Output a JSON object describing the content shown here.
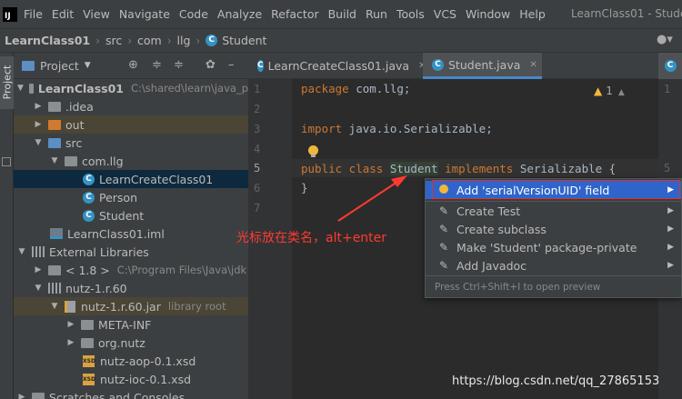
{
  "menubar": {
    "logo": "IJ",
    "items": [
      "File",
      "Edit",
      "View",
      "Navigate",
      "Code",
      "Analyze",
      "Refactor",
      "Build",
      "Run",
      "Tools",
      "VCS",
      "Window",
      "Help"
    ],
    "window_title": "LearnClass01 - Stude"
  },
  "breadcrumb": {
    "items": [
      "LearnClass01",
      "src",
      "com",
      "llg",
      "Student"
    ]
  },
  "left_tool": {
    "label": "Project"
  },
  "project_panel": {
    "title": "Project",
    "tree": [
      {
        "label": "LearnClass01",
        "extra": "C:\\shared\\learn\\java_p",
        "bold": true
      },
      {
        "label": ".idea"
      },
      {
        "label": "out"
      },
      {
        "label": "src"
      },
      {
        "label": "com.llg"
      },
      {
        "label": "LearnCreateClass01"
      },
      {
        "label": "Person"
      },
      {
        "label": "Student"
      },
      {
        "label": "LearnClass01.iml"
      },
      {
        "label": "External Libraries"
      },
      {
        "label": "< 1.8 >",
        "extra": "C:\\Program Files\\Java\\jdk"
      },
      {
        "label": "nutz-1.r.60"
      },
      {
        "label": "nutz-1.r.60.jar",
        "extra": "library root"
      },
      {
        "label": "META-INF"
      },
      {
        "label": "org.nutz"
      },
      {
        "label": "nutz-aop-0.1.xsd"
      },
      {
        "label": "nutz-ioc-0.1.xsd"
      },
      {
        "label": "Scratches and Consoles"
      }
    ],
    "class_icon_letter": "C",
    "xsd_icon_text": "XSD"
  },
  "tabs": [
    {
      "label": "LearnCreateClass01.java",
      "active": false
    },
    {
      "label": "Student.java",
      "active": true
    }
  ],
  "tab_close": "✕",
  "gutter": {
    "lines": [
      "1",
      "2",
      "3",
      "4",
      "5",
      "6",
      "7"
    ],
    "current_line": "5"
  },
  "editor": {
    "warning_count": "1",
    "lines": [
      {
        "kw1": "package",
        "rest": " com.llg;"
      },
      {},
      {
        "kw1": "import",
        "rest": " java.io.Serializable;"
      },
      {},
      {
        "kw1": "public class",
        "name": "Student",
        "kw2": "implements",
        "rest": " Serializable {"
      },
      {
        "rest": "}"
      }
    ]
  },
  "right_strip": {
    "lines": [
      "1",
      "5"
    ]
  },
  "popup": {
    "items": [
      {
        "label": "Add 'serialVersionUID' field",
        "selected": true
      },
      {
        "label": "Create Test"
      },
      {
        "label": "Create subclass"
      },
      {
        "label": "Make 'Student' package-private"
      },
      {
        "label": "Add Javadoc"
      }
    ],
    "footer": "Press Ctrl+Shift+I to open preview"
  },
  "annotation": {
    "text": "光标放在类名，alt+enter",
    "color": "#ff3b30"
  },
  "watermark": "https://blog.csdn.net/qq_27865153",
  "colors": {
    "keyword": "#cc7832",
    "selection": "#2f65ca",
    "accent": "#4a88c7"
  }
}
